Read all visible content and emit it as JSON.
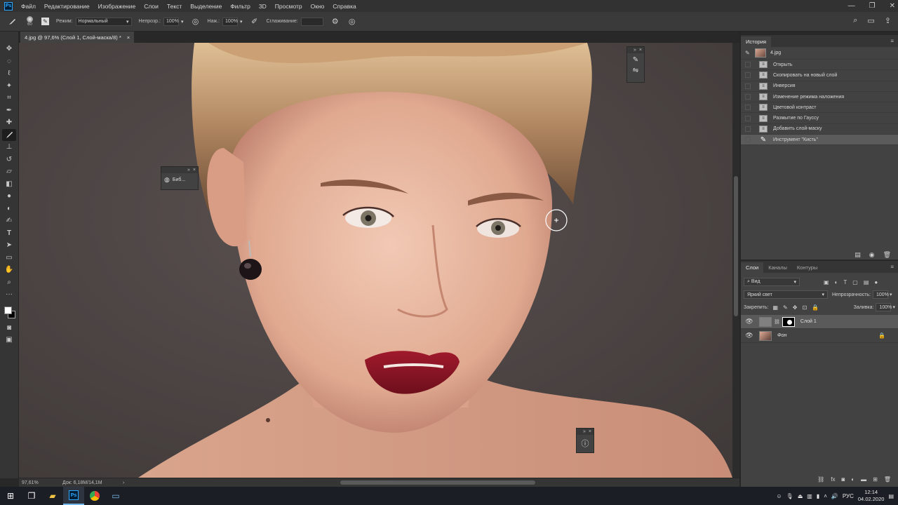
{
  "app": {
    "logo": "Ps"
  },
  "menu": [
    "Файл",
    "Редактирование",
    "Изображение",
    "Слои",
    "Текст",
    "Выделение",
    "Фильтр",
    "3D",
    "Просмотр",
    "Окно",
    "Справка"
  ],
  "options_bar": {
    "brush_size": "60",
    "mode_label": "Режим:",
    "mode_value": "Нормальный",
    "opacity_label": "Непрозр.:",
    "opacity_value": "100%",
    "pressure_label": "Наж.:",
    "pressure_value": "100%",
    "smoothing_label": "Сглаживание:",
    "smoothing_value": ""
  },
  "document": {
    "tab_title": "4.jpg @ 97,6% (Слой 1, Слой-маска/8) *",
    "close": "×"
  },
  "status": {
    "zoom": "97,61%",
    "doc_info": "Док: 6,18M/14,1M",
    "arrow": "›"
  },
  "mini_panels": {
    "libraries_label": "Биб...",
    "collapse": "»",
    "close": "×"
  },
  "history": {
    "tab": "История",
    "snapshot": "4.jpg",
    "items": [
      "Открыть",
      "Скопировать на новый слой",
      "Инверсия",
      "Изменение режима наложения",
      "Цветовой контраст",
      "Размытие по Гауссу",
      "Добавить слой-маску",
      "Инструмент \"Кисть\""
    ],
    "selected_index": 7
  },
  "layers": {
    "tabs": [
      "Слои",
      "Каналы",
      "Контуры"
    ],
    "filter_label": "Вид",
    "blend_mode": "Яркий свет",
    "opacity_label": "Непрозрачность:",
    "opacity_value": "100%",
    "lock_label": "Закрепить:",
    "fill_label": "Заливка:",
    "fill_value": "100%",
    "items": [
      {
        "name": "Слой 1",
        "selected": true
      },
      {
        "name": "Фон",
        "locked": true
      }
    ]
  },
  "taskbar": {
    "language": "РУС",
    "time": "12:14",
    "date": "04.02.2020"
  },
  "icons": {
    "brush": "brush-icon",
    "search": "search-icon",
    "workspace": "workspace-icon",
    "share": "share-icon"
  }
}
